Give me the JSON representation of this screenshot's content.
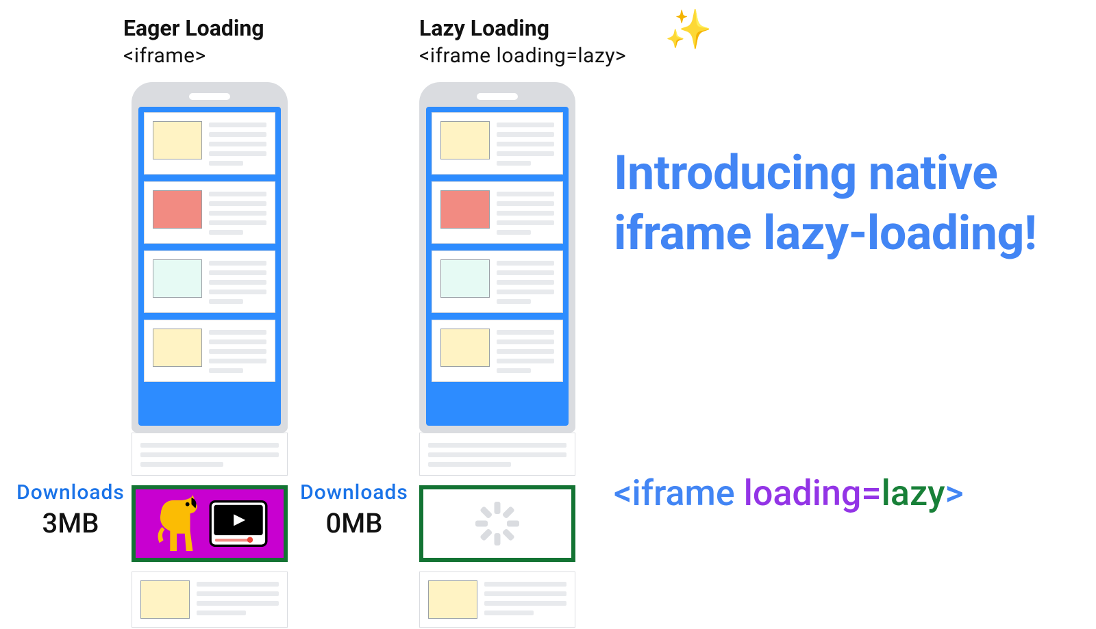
{
  "columns": {
    "eager": {
      "title": "Eager Loading",
      "subtitle": "<iframe>"
    },
    "lazy": {
      "title": "Lazy Loading",
      "subtitle": "<iframe loading=lazy>"
    }
  },
  "downloads": {
    "label": "Downloads",
    "eager_value": "3MB",
    "lazy_value": "0MB"
  },
  "headline": "Introducing native iframe lazy-loading!",
  "code": {
    "open": "<iframe ",
    "attr": "loading=",
    "value": "lazy",
    "close": ">"
  },
  "icons": {
    "sparkles": "✨"
  }
}
